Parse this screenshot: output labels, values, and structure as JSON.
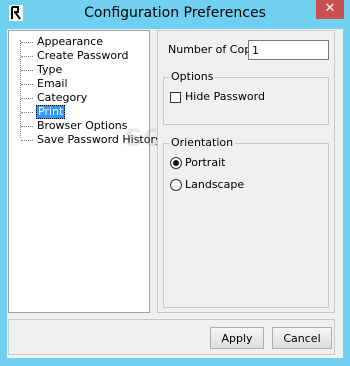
{
  "window": {
    "title": "Configuration Preferences",
    "close_glyph": "✕"
  },
  "tree": {
    "items": [
      {
        "label": "Appearance",
        "selected": false
      },
      {
        "label": "Create Password",
        "selected": false
      },
      {
        "label": "Type",
        "selected": false
      },
      {
        "label": "Email",
        "selected": false
      },
      {
        "label": "Category",
        "selected": false
      },
      {
        "label": "Print",
        "selected": true
      },
      {
        "label": "Browser Options",
        "selected": false
      },
      {
        "label": "Save Password History",
        "selected": false
      }
    ]
  },
  "print": {
    "copies_label": "Number of Copy",
    "copies_value": "1",
    "options": {
      "title": "Options",
      "hide_password_label": "Hide Password",
      "hide_password_checked": false
    },
    "orientation": {
      "title": "Orientation",
      "portrait_label": "Portrait",
      "landscape_label": "Landscape",
      "selected": "Portrait"
    }
  },
  "buttons": {
    "apply": "Apply",
    "cancel": "Cancel"
  },
  "watermark": "SOFTPEDIA",
  "colors": {
    "title_bar": "#6fd0f0",
    "close_button": "#c75050",
    "selection": "#3399ff"
  }
}
